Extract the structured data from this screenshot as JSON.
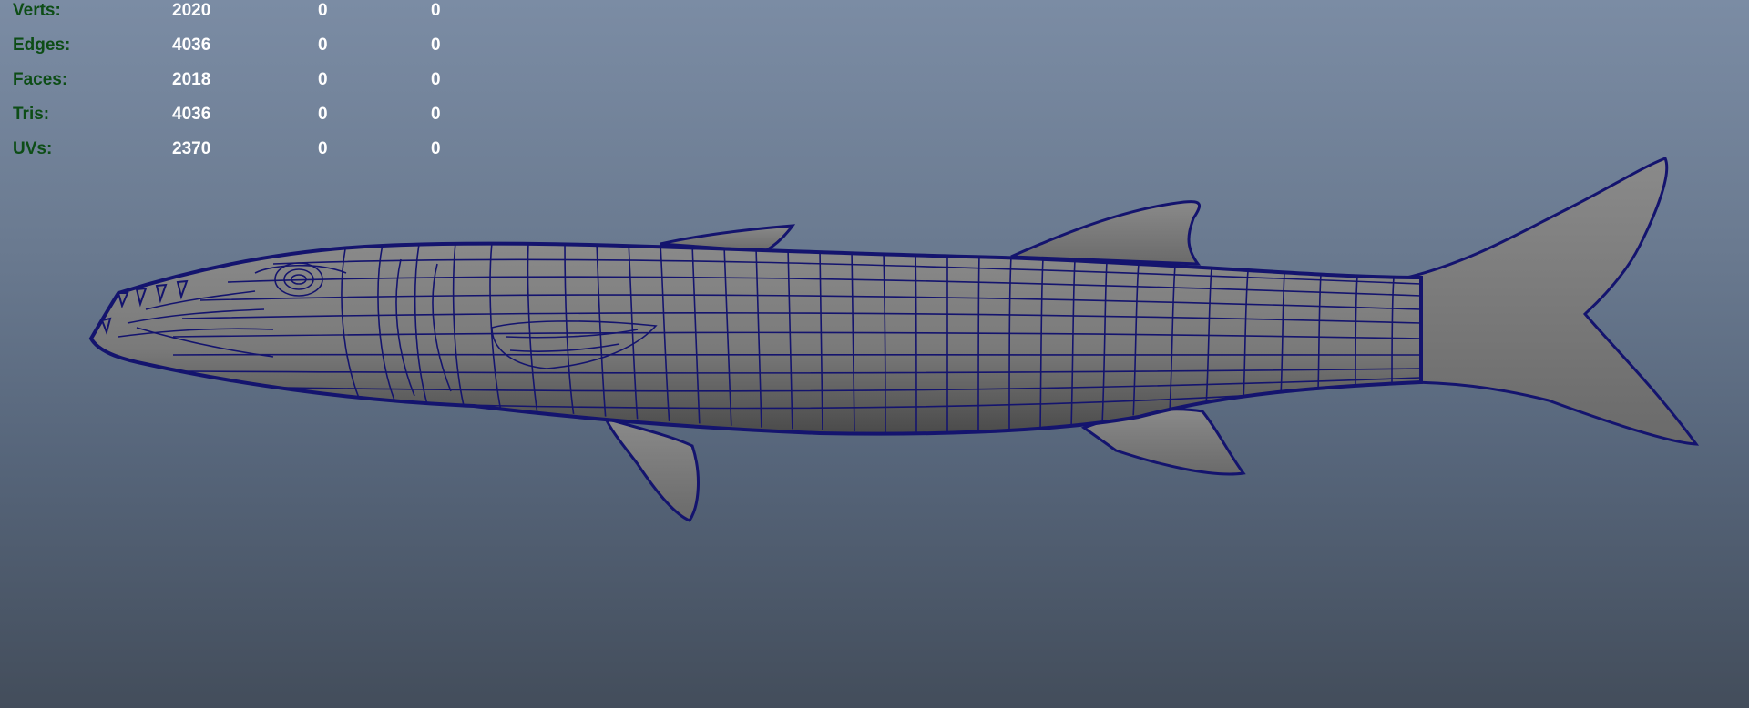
{
  "viewport": {
    "background_top": "#7b8ca4",
    "background_bottom": "#434d5b",
    "wire_color": "#14146e",
    "shade_color": "#7c7c7c",
    "model_name": "barracuda-mesh"
  },
  "hud": {
    "rows": [
      {
        "label": "Verts:",
        "c1": "2020",
        "c2": "0",
        "c3": "0"
      },
      {
        "label": "Edges:",
        "c1": "4036",
        "c2": "0",
        "c3": "0"
      },
      {
        "label": "Faces:",
        "c1": "2018",
        "c2": "0",
        "c3": "0"
      },
      {
        "label": "Tris:",
        "c1": "4036",
        "c2": "0",
        "c3": "0"
      },
      {
        "label": "UVs:",
        "c1": "2370",
        "c2": "0",
        "c3": "0"
      }
    ]
  }
}
